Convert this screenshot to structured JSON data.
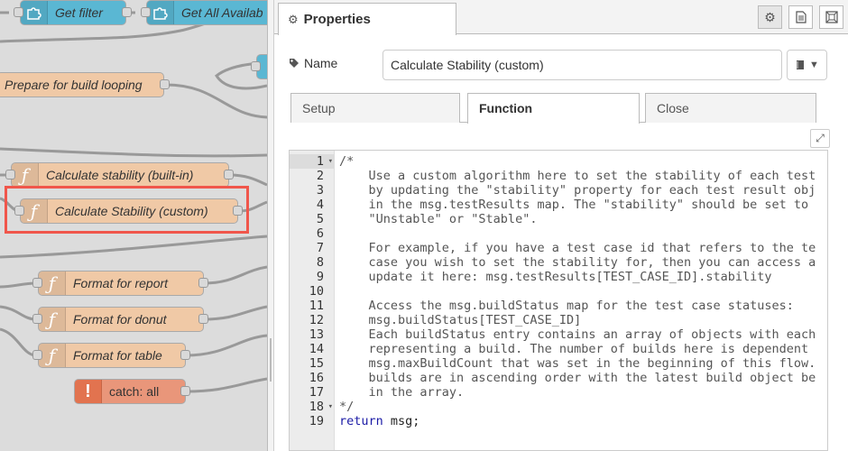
{
  "canvas": {
    "nodes": [
      {
        "id": "get-filter",
        "label": "Get filter",
        "kind": "blue",
        "icon": "puzzle-icon"
      },
      {
        "id": "get-all",
        "label": "Get All Availab",
        "kind": "blue",
        "icon": "puzzle-icon"
      },
      {
        "id": "prepare",
        "label": "Prepare for build looping",
        "kind": "fn-plain",
        "icon": ""
      },
      {
        "id": "calc-builtin",
        "label": "Calculate stability (built-in)",
        "kind": "fn",
        "icon": "function-icon"
      },
      {
        "id": "calc-custom",
        "label": "Calculate Stability (custom)",
        "kind": "fn",
        "icon": "function-icon"
      },
      {
        "id": "fmt-report",
        "label": "Format for report",
        "kind": "fn",
        "icon": "function-icon"
      },
      {
        "id": "fmt-donut",
        "label": "Format for donut",
        "kind": "fn",
        "icon": "function-icon"
      },
      {
        "id": "fmt-table",
        "label": "Format for table",
        "kind": "fn",
        "icon": "function-icon"
      },
      {
        "id": "catch-all",
        "label": "catch: all",
        "kind": "catch",
        "icon": "exclamation-icon"
      }
    ]
  },
  "panel": {
    "tab_title": "Properties",
    "tab_icon": "gear-icon",
    "header_buttons": [
      {
        "name": "node-settings-button",
        "icon": "gear-icon"
      },
      {
        "name": "node-description-button",
        "icon": "document-icon"
      },
      {
        "name": "node-appearance-button",
        "icon": "frame-icon"
      }
    ],
    "name_label": "Name",
    "name_value": "Calculate Stability (custom)",
    "tabs": [
      {
        "label": "Setup",
        "active": false
      },
      {
        "label": "Function",
        "active": true
      },
      {
        "label": "Close",
        "active": false
      }
    ]
  },
  "editor": {
    "lines": [
      "/*",
      "    Use a custom algorithm here to set the stability of each test",
      "    by updating the \"stability\" property for each test result obj",
      "    in the msg.testResults map. The \"stability\" should be set to",
      "    \"Unstable\" or \"Stable\".",
      "",
      "    For example, if you have a test case id that refers to the te",
      "    case you wish to set the stability for, then you can access a",
      "    update it here: msg.testResults[TEST_CASE_ID].stability",
      "",
      "    Access the msg.buildStatus map for the test case statuses:",
      "    msg.buildStatus[TEST_CASE_ID]",
      "    Each buildStatus entry contains an array of objects with each",
      "    representing a build. The number of builds here is dependent",
      "    msg.maxBuildCount that was set in the beginning of this flow.",
      "    builds are in ascending order with the latest build object be",
      "    in the array.",
      "*/",
      "return msg;"
    ],
    "fold_lines": [
      1,
      18
    ],
    "active_line": 1
  }
}
